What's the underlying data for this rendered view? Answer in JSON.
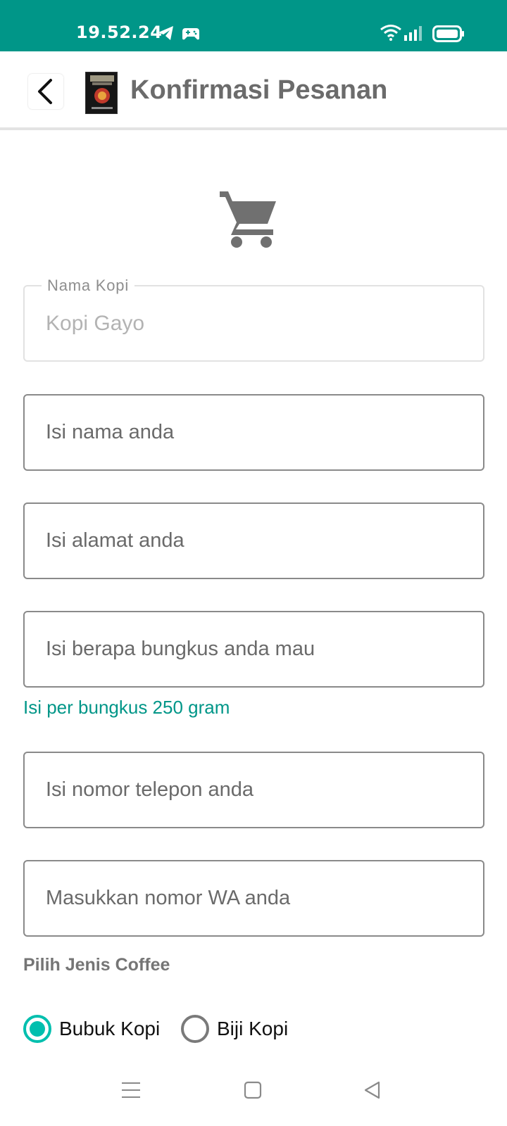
{
  "status_bar": {
    "time": "19.52.24",
    "background": "#009688",
    "icons": [
      "telegram-icon",
      "gamepad-icon",
      "wifi-icon",
      "signal-icon",
      "battery-icon"
    ]
  },
  "app_bar": {
    "title": "Konfirmasi Pesanan",
    "back_icon": "chevron-left-icon",
    "logo": "coffee-logo"
  },
  "cart_icon": "shopping-cart-icon",
  "form": {
    "coffee_name": {
      "label": "Nama Kopi",
      "value": "Kopi Gayo"
    },
    "name": {
      "placeholder": "Isi nama anda"
    },
    "address": {
      "placeholder": "Isi alamat anda"
    },
    "quantity": {
      "placeholder": "Isi berapa bungkus anda mau",
      "helper": "Isi per bungkus 250 gram"
    },
    "phone": {
      "placeholder": "Isi nomor telepon anda"
    },
    "whatsapp": {
      "placeholder": "Masukkan nomor WA anda"
    },
    "coffee_type": {
      "label": "Pilih Jenis Coffee",
      "options": [
        {
          "label": "Bubuk Kopi",
          "selected": true
        },
        {
          "label": "Biji Kopi",
          "selected": false
        }
      ]
    }
  },
  "colors": {
    "primary": "#009688",
    "radio_accent": "#00bfae",
    "title_gray": "#6b6b6b"
  },
  "nav_bar": {
    "buttons": [
      "menu-icon",
      "home-icon",
      "back-triangle-icon"
    ]
  }
}
